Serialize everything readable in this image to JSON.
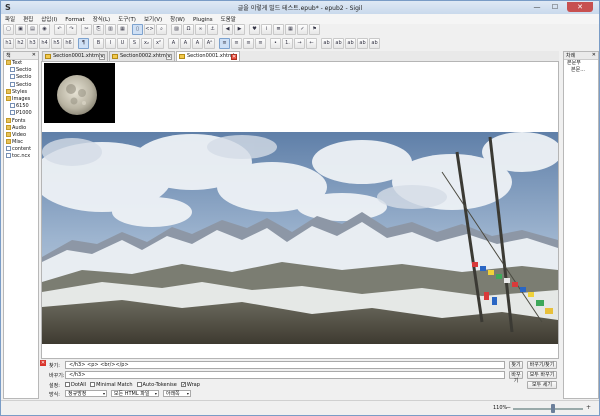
{
  "window": {
    "title": "글을 이렇게 빌드 테스트.epub* - epub2 - Sigil",
    "app_glyph": "S",
    "min_label": "—",
    "max_label": "☐",
    "close_label": "✕"
  },
  "menu": [
    "파일",
    "편집",
    "삽입(I)",
    "Format",
    "장식(L)",
    "도구(T)",
    "보기(V)",
    "창(W)",
    "Plugins",
    "도움말"
  ],
  "toolbar1": [
    {
      "icon": "new-file-icon",
      "glyph": "▢"
    },
    {
      "icon": "add-file-icon",
      "glyph": "▣"
    },
    {
      "icon": "open-icon",
      "glyph": "▤"
    },
    {
      "icon": "save-icon",
      "glyph": "◉"
    },
    {
      "icon": "undo-icon",
      "glyph": "↶"
    },
    {
      "icon": "redo-icon",
      "glyph": "↷"
    },
    {
      "icon": "cut-icon",
      "glyph": "✂"
    },
    {
      "icon": "copy-icon",
      "glyph": "⎘"
    },
    {
      "icon": "paste-icon",
      "glyph": "▥"
    },
    {
      "icon": "paste-special-icon",
      "glyph": "▦"
    },
    {
      "icon": "book-view-icon",
      "glyph": "▯"
    },
    {
      "icon": "code-view-icon",
      "glyph": "<>"
    },
    {
      "icon": "search-icon",
      "glyph": "⌕"
    },
    {
      "icon": "image-icon",
      "glyph": "▨"
    },
    {
      "icon": "special-char-icon",
      "glyph": "Ω"
    },
    {
      "icon": "link-icon",
      "glyph": "∞"
    },
    {
      "icon": "anchor-icon",
      "glyph": "⚓"
    },
    {
      "icon": "back-icon",
      "glyph": "◀"
    },
    {
      "icon": "play-icon",
      "glyph": "▶"
    },
    {
      "icon": "heart-icon",
      "glyph": "♥"
    },
    {
      "icon": "info-icon",
      "glyph": "i"
    },
    {
      "icon": "list-icon",
      "glyph": "≣"
    },
    {
      "icon": "table-icon",
      "glyph": "▦"
    },
    {
      "icon": "check-icon",
      "glyph": "✓"
    },
    {
      "icon": "spell-icon",
      "glyph": "⚑"
    }
  ],
  "toolbar2": [
    {
      "icon": "heading1-icon",
      "glyph": "h1"
    },
    {
      "icon": "heading2-icon",
      "glyph": "h2"
    },
    {
      "icon": "heading3-icon",
      "glyph": "h3"
    },
    {
      "icon": "heading4-icon",
      "glyph": "h4"
    },
    {
      "icon": "heading5-icon",
      "glyph": "h5"
    },
    {
      "icon": "heading6-icon",
      "glyph": "h6"
    },
    {
      "icon": "paragraph-icon",
      "glyph": "¶"
    },
    {
      "icon": "bold-icon",
      "glyph": "B"
    },
    {
      "icon": "italic-icon",
      "glyph": "I"
    },
    {
      "icon": "underline-icon",
      "glyph": "U"
    },
    {
      "icon": "strikethrough-icon",
      "glyph": "S"
    },
    {
      "icon": "subscript-icon",
      "glyph": "x₂"
    },
    {
      "icon": "superscript-icon",
      "glyph": "x²"
    },
    {
      "icon": "text-a-icon",
      "glyph": "A"
    },
    {
      "icon": "text-a2-icon",
      "glyph": "A"
    },
    {
      "icon": "text-a3-icon",
      "glyph": "A"
    },
    {
      "icon": "font-size-icon",
      "glyph": "Aᴬ"
    },
    {
      "icon": "align-left-icon",
      "glyph": "≡"
    },
    {
      "icon": "align-center-icon",
      "glyph": "≡"
    },
    {
      "icon": "align-right-icon",
      "glyph": "≡"
    },
    {
      "icon": "justify-icon",
      "glyph": "≡"
    },
    {
      "icon": "bullets-icon",
      "glyph": "•"
    },
    {
      "icon": "numbering-icon",
      "glyph": "1."
    },
    {
      "icon": "indent-icon",
      "glyph": "→"
    },
    {
      "icon": "outdent-icon",
      "glyph": "←"
    },
    {
      "icon": "ab-icon",
      "glyph": "ab"
    },
    {
      "icon": "ab2-icon",
      "glyph": "ab"
    },
    {
      "icon": "ab3-icon",
      "glyph": "ab"
    },
    {
      "icon": "ab4-icon",
      "glyph": "ab"
    },
    {
      "icon": "ab5-icon",
      "glyph": "ab"
    }
  ],
  "bookbrowser": {
    "title": "책",
    "close": "✕",
    "items": [
      {
        "label": "Text",
        "type": "folder",
        "depth": 0
      },
      {
        "label": "Sectio",
        "type": "file",
        "depth": 1
      },
      {
        "label": "Sectio",
        "type": "file",
        "depth": 1
      },
      {
        "label": "Sectio",
        "type": "file",
        "depth": 1
      },
      {
        "label": "Styles",
        "type": "folder",
        "depth": 0
      },
      {
        "label": "Images",
        "type": "folder",
        "depth": 0
      },
      {
        "label": "6150",
        "type": "file",
        "depth": 1
      },
      {
        "label": "P1000",
        "type": "file",
        "depth": 1
      },
      {
        "label": "Fonts",
        "type": "folder",
        "depth": 0
      },
      {
        "label": "Audio",
        "type": "folder",
        "depth": 0
      },
      {
        "label": "Video",
        "type": "folder",
        "depth": 0
      },
      {
        "label": "Misc",
        "type": "folder",
        "depth": 0
      },
      {
        "label": "content",
        "type": "file",
        "depth": 0
      },
      {
        "label": "toc.ncx",
        "type": "file",
        "depth": 0
      }
    ]
  },
  "tabs": [
    {
      "label": "Section0001.xhtml",
      "close": "✕"
    },
    {
      "label": "Section0002.xhtml",
      "close": "✕"
    },
    {
      "label": "Section0001.xhtml",
      "close": "✕"
    }
  ],
  "toc": {
    "title": "차례",
    "close": "✕",
    "items": [
      "본문부",
      "본문..."
    ]
  },
  "find": {
    "find_label": "찾기:",
    "find_value": "</h3>    <p> <br/></p>",
    "replace_label": "바꾸기:",
    "replace_value": "</h3>",
    "find_button": "찾기",
    "replace_find_button": "바꾸기/찾기",
    "replace_button": "바꾸기",
    "replace_all_button": "모두 바꾸기",
    "count_all_button": "모두 세기",
    "options_label": "설정:",
    "options": [
      {
        "label": "DotAll",
        "checked": false
      },
      {
        "label": "Minimal Match",
        "checked": false
      },
      {
        "label": "Auto-Tokenise",
        "checked": false
      },
      {
        "label": "Wrap",
        "checked": true
      }
    ],
    "mode_label": "방식:",
    "mode_value": "정규방정",
    "scope_value": "모든 HTML 파일",
    "direction_value": "아래쪽",
    "dropdown_arrow": "▾",
    "close_glyph": "✕",
    "check_glyph": "✓"
  },
  "status": {
    "zoom": "110%",
    "zoom_fraction": 0.57,
    "minus": "−",
    "plus": "+"
  }
}
